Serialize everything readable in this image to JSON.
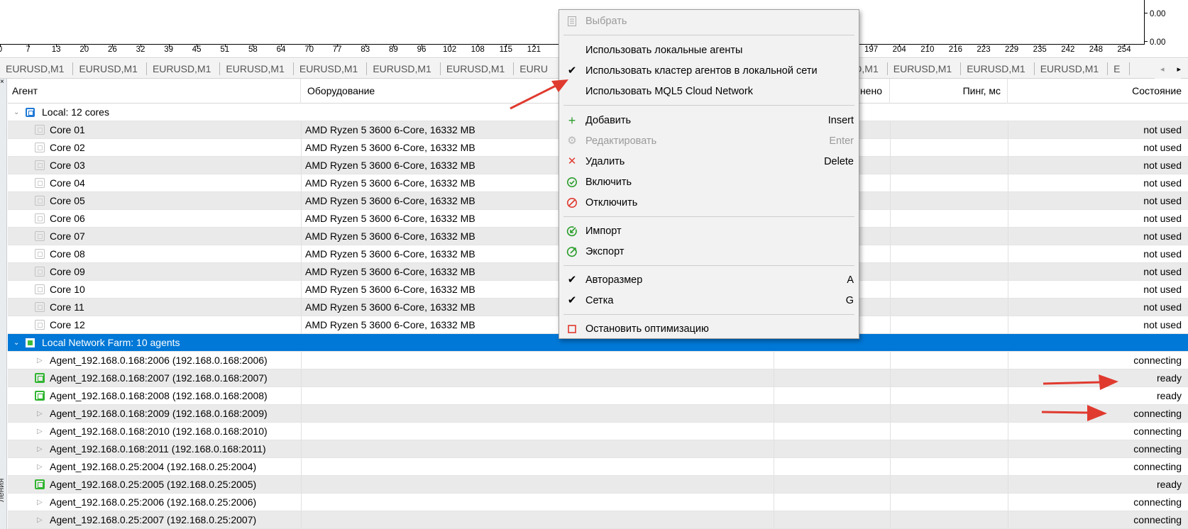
{
  "chart": {
    "x_ticks": [
      "0",
      "7",
      "13",
      "20",
      "26",
      "32",
      "39",
      "45",
      "51",
      "58",
      "64",
      "70",
      "77",
      "83",
      "89",
      "96",
      "102",
      "108",
      "115",
      "121",
      "",
      "",
      "",
      "",
      "",
      "",
      "",
      "",
      "",
      "",
      "",
      "197",
      "204",
      "210",
      "216",
      "223",
      "229",
      "235",
      "242",
      "248",
      "254"
    ],
    "y_labels": [
      "0.00",
      "0.00"
    ]
  },
  "symbol_tabs": [
    "EURUSD,M1",
    "EURUSD,M1",
    "EURUSD,M1",
    "EURUSD,M1",
    "EURUSD,M1",
    "EURUSD,M1",
    "EURUSD,M1",
    "EURU",
    "SD,M1",
    "EURUSD,M1",
    "EURUSD,M1",
    "EURUSD,M1",
    "E"
  ],
  "tab_nav": {
    "prev": "◂",
    "next": "▸"
  },
  "left_panel": {
    "close": "×",
    "vertical_text": "ления"
  },
  "grid": {
    "headers": {
      "agent": "Агент",
      "hardware": "Оборудование",
      "done": "нено",
      "ping": "Пинг, мс",
      "state": "Состояние"
    },
    "local_group": {
      "caret": "⌄",
      "label": "Local: 12 cores"
    },
    "cores": [
      {
        "name": "Core 01",
        "hw": "AMD Ryzen 5 3600 6-Core, 16332 MB",
        "state": "not used"
      },
      {
        "name": "Core 02",
        "hw": "AMD Ryzen 5 3600 6-Core, 16332 MB",
        "state": "not used"
      },
      {
        "name": "Core 03",
        "hw": "AMD Ryzen 5 3600 6-Core, 16332 MB",
        "state": "not used"
      },
      {
        "name": "Core 04",
        "hw": "AMD Ryzen 5 3600 6-Core, 16332 MB",
        "state": "not used"
      },
      {
        "name": "Core 05",
        "hw": "AMD Ryzen 5 3600 6-Core, 16332 MB",
        "state": "not used"
      },
      {
        "name": "Core 06",
        "hw": "AMD Ryzen 5 3600 6-Core, 16332 MB",
        "state": "not used"
      },
      {
        "name": "Core 07",
        "hw": "AMD Ryzen 5 3600 6-Core, 16332 MB",
        "state": "not used"
      },
      {
        "name": "Core 08",
        "hw": "AMD Ryzen 5 3600 6-Core, 16332 MB",
        "state": "not used"
      },
      {
        "name": "Core 09",
        "hw": "AMD Ryzen 5 3600 6-Core, 16332 MB",
        "state": "not used"
      },
      {
        "name": "Core 10",
        "hw": "AMD Ryzen 5 3600 6-Core, 16332 MB",
        "state": "not used"
      },
      {
        "name": "Core 11",
        "hw": "AMD Ryzen 5 3600 6-Core, 16332 MB",
        "state": "not used"
      },
      {
        "name": "Core 12",
        "hw": "AMD Ryzen 5 3600 6-Core, 16332 MB",
        "state": "not used"
      }
    ],
    "farm_group": {
      "caret": "⌄",
      "label": "Local Network Farm: 10 agents"
    },
    "agents": [
      {
        "name": "Agent_192.168.0.168:2006 (192.168.0.168:2006)",
        "state": "connecting",
        "icon": "arrow"
      },
      {
        "name": "Agent_192.168.0.168:2007 (192.168.0.168:2007)",
        "state": "ready",
        "icon": "chip"
      },
      {
        "name": "Agent_192.168.0.168:2008 (192.168.0.168:2008)",
        "state": "ready",
        "icon": "chip"
      },
      {
        "name": "Agent_192.168.0.168:2009 (192.168.0.168:2009)",
        "state": "connecting",
        "icon": "arrow"
      },
      {
        "name": "Agent_192.168.0.168:2010 (192.168.0.168:2010)",
        "state": "connecting",
        "icon": "arrow"
      },
      {
        "name": "Agent_192.168.0.168:2011 (192.168.0.168:2011)",
        "state": "connecting",
        "icon": "arrow"
      },
      {
        "name": "Agent_192.168.0.25:2004 (192.168.0.25:2004)",
        "state": "connecting",
        "icon": "arrow"
      },
      {
        "name": "Agent_192.168.0.25:2005 (192.168.0.25:2005)",
        "state": "ready",
        "icon": "chip"
      },
      {
        "name": "Agent_192.168.0.25:2006 (192.168.0.25:2006)",
        "state": "connecting",
        "icon": "arrow"
      },
      {
        "name": "Agent_192.168.0.25:2007 (192.168.0.25:2007)",
        "state": "connecting",
        "icon": "arrow"
      }
    ]
  },
  "context_menu": {
    "select": "Выбрать",
    "use_local": "Использовать локальные агенты",
    "use_cluster": "Использовать кластер агентов в локальной сети",
    "use_cloud": "Использовать MQL5 Cloud Network",
    "add": "Добавить",
    "add_key": "Insert",
    "edit": "Редактировать",
    "edit_key": "Enter",
    "delete": "Удалить",
    "delete_key": "Delete",
    "enable": "Включить",
    "disable": "Отключить",
    "import": "Импорт",
    "export": "Экспорт",
    "autosize": "Авторазмер",
    "autosize_key": "A",
    "grid": "Сетка",
    "grid_key": "G",
    "stop": "Остановить оптимизацию",
    "check": "✔"
  },
  "colors": {
    "selection": "#0078d7",
    "ready_chip": "#2fb52f",
    "annotation_arrow": "#e03a2f"
  }
}
